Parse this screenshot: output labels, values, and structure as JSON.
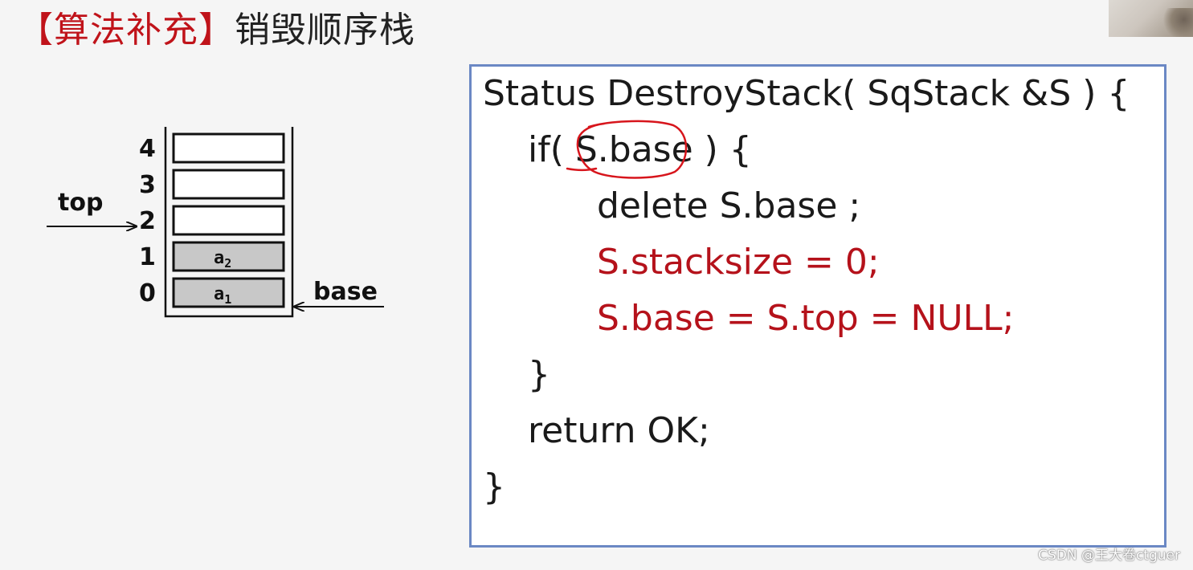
{
  "title": {
    "bracketed": "【算法补充】",
    "main": "销毁顺序栈"
  },
  "stack_diagram": {
    "indices": [
      "4",
      "3",
      "2",
      "1",
      "0"
    ],
    "cells": [
      {
        "index": "4",
        "filled": false,
        "value": "",
        "subscript": ""
      },
      {
        "index": "3",
        "filled": false,
        "value": "",
        "subscript": ""
      },
      {
        "index": "2",
        "filled": false,
        "value": "",
        "subscript": ""
      },
      {
        "index": "1",
        "filled": true,
        "value": "a",
        "subscript": "2"
      },
      {
        "index": "0",
        "filled": true,
        "value": "a",
        "subscript": "1"
      }
    ],
    "top_label": "top",
    "base_label": "base",
    "top_points_to": "2",
    "base_points_to": "0",
    "filled_color": "#c8c8c8"
  },
  "code": {
    "lines": [
      {
        "text": "Status DestroyStack( SqStack &S ) {",
        "color": "black"
      },
      {
        "text": "if( S.base ) {",
        "color": "black"
      },
      {
        "text": "delete S.base ;",
        "color": "black"
      },
      {
        "text": "S.stacksize = 0;",
        "color": "red"
      },
      {
        "text": "S.base = S.top = NULL;",
        "color": "red"
      },
      {
        "text": "}",
        "color": "black"
      },
      {
        "text": "return OK;",
        "color": "black"
      },
      {
        "text": "}",
        "color": "black"
      }
    ],
    "highlighted_token": "S.base",
    "box_border_color": "#6b88c4",
    "highlight_color": "#b5121b"
  },
  "watermark": "CSDN @王大卷ctguer"
}
